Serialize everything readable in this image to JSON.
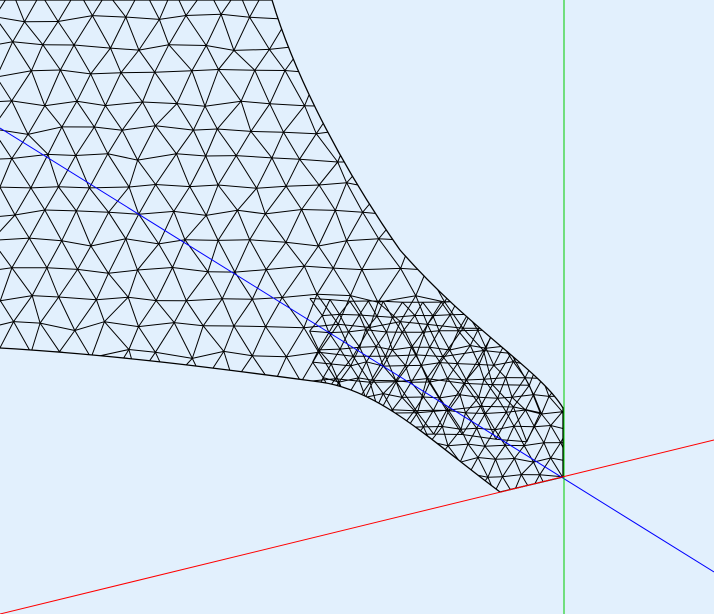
{
  "viewport": {
    "background_color": "#e2f0fd"
  },
  "mesh": {
    "element_type": "triangular",
    "wire_color": "#000000",
    "fill": "none"
  },
  "axes": {
    "x_axis_color": "#ff0000",
    "y_axis_color": "#00cc00",
    "z_axis_color": "#0000ff"
  }
}
